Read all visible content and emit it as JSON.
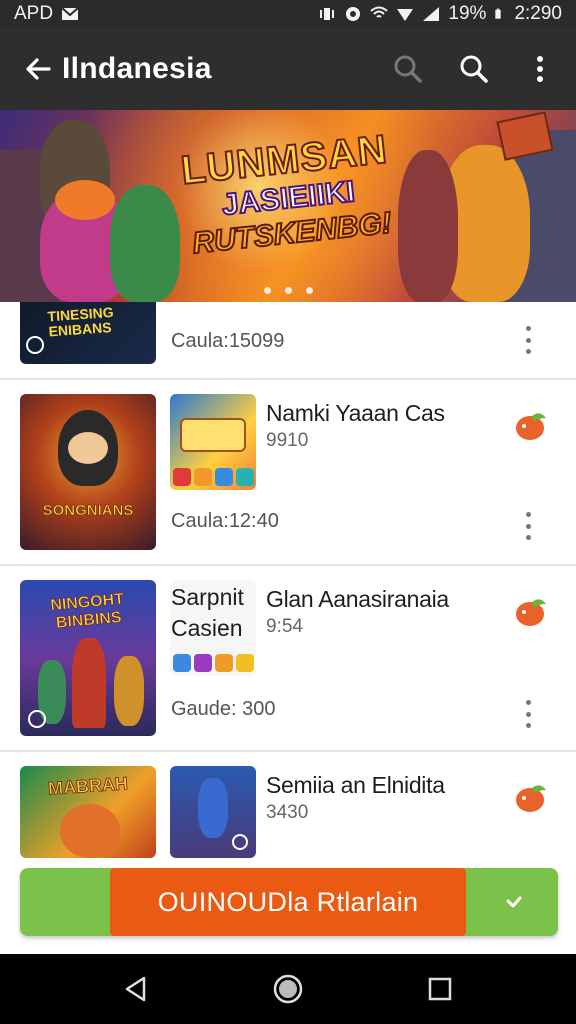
{
  "status_bar": {
    "left_text": "APD",
    "battery": "19%",
    "time": "2:290"
  },
  "app_bar": {
    "title": "Ilndanesia"
  },
  "banner": {
    "line1": "LUNMSAN",
    "line2": "JASIEIIKI",
    "line3": "RUTSKENBG!",
    "slide_count": 3
  },
  "list": {
    "items": [
      {
        "thumb_text": "TINESING ENIBANS",
        "meta": "Caula:15099"
      },
      {
        "thumb_text": "SONGNIANS",
        "name": "Namki Yaaan Cas",
        "count": "9910",
        "meta": "Caula:12:40"
      },
      {
        "thumb_text": "NINGOHT BINBINS",
        "sub_line1": "Sarpnit",
        "sub_line2": "Casien",
        "name": "Glan Aanasiranaia",
        "count": "9:54",
        "meta": "Gaude: 300"
      },
      {
        "thumb_text": "MABRAH",
        "name": "Semiia an Elnidita",
        "count": "3430"
      }
    ]
  },
  "download_button": {
    "label": "OUINOUDla Rtlarlain"
  },
  "colors": {
    "app_bar": "#2e2e2e",
    "accent_orange": "#ea5a12",
    "accent_green": "#7cc24a"
  }
}
